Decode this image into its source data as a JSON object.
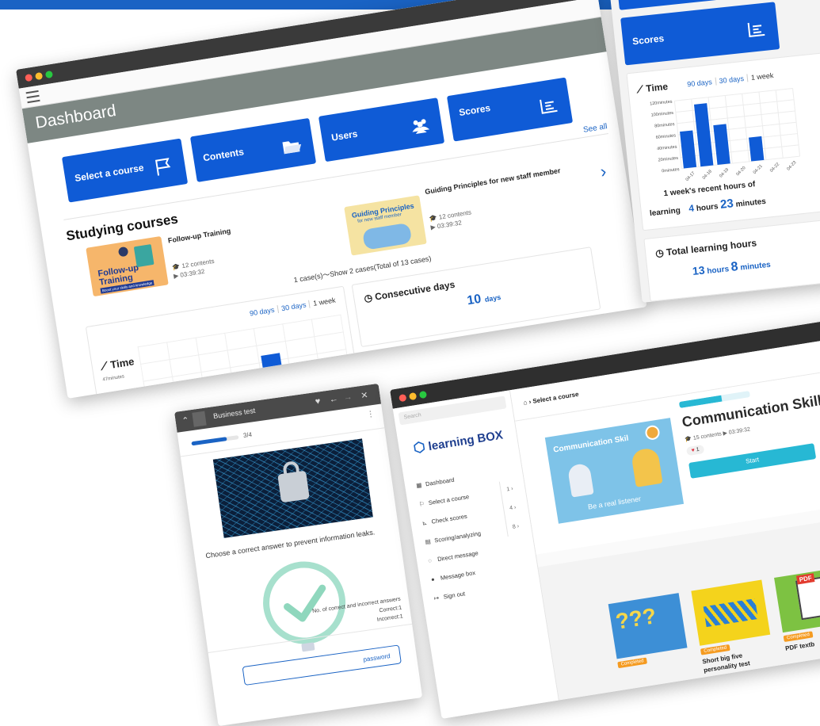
{
  "dashboard": {
    "title": "Dashboard",
    "tiles": [
      {
        "label": "Select a course",
        "icon": "flag-icon"
      },
      {
        "label": "Contents",
        "icon": "folder-icon"
      },
      {
        "label": "Users",
        "icon": "users-icon"
      },
      {
        "label": "Scores",
        "icon": "scores-icon"
      }
    ],
    "see_all": "See all",
    "studying_title": "Studying courses",
    "courses": [
      {
        "name": "Follow-up Training",
        "thumb_title": "Follow-up Training",
        "thumb_sub": "Boost your skills and knowledge",
        "contents": "12 contents",
        "duration": "03:39:32"
      },
      {
        "name": "Guiding Principles for new staff member",
        "thumb_title": "Guiding Principles",
        "thumb_sub": "for new staff member",
        "contents": "12 contents",
        "duration": "03:39:32"
      }
    ],
    "pager": "1 case(s)～Show 2 cases(Total of 13 cases)",
    "time_panel": {
      "title": "Time",
      "tabs": [
        "90 days",
        "30 days",
        "1 week"
      ],
      "y_ticks": [
        "47minutes",
        "40minutes"
      ]
    },
    "consecutive": {
      "title": "Consecutive days",
      "value": "10",
      "unit": "days"
    }
  },
  "scores": {
    "title": "Scores",
    "time_title": "Time",
    "tabs": [
      "90 days",
      "30 days",
      "1 week"
    ],
    "summary_line1": "1 week's recent hours of",
    "summary_prefix": "learning",
    "summary_hours": "4",
    "summary_hours_unit": "hours",
    "summary_minutes": "23",
    "summary_minutes_unit": "minutes",
    "total_title": "Total learning hours",
    "total_hours": "13",
    "total_hours_unit": "hours",
    "total_minutes": "8",
    "total_minutes_unit": "minutes"
  },
  "chart_data": {
    "type": "bar",
    "categories": [
      "04-17",
      "04-18",
      "04-19",
      "04-20",
      "04-21",
      "04-22",
      "04-23"
    ],
    "values": [
      65,
      110,
      70,
      0,
      42,
      0,
      0
    ],
    "ylim": [
      0,
      120
    ],
    "y_ticks": [
      "120minutes",
      "100minutes",
      "80minutes",
      "60minutes",
      "40minutes",
      "20minutes",
      "0minutes"
    ],
    "grid": true
  },
  "quiz": {
    "title": "Business test",
    "progress_label": "3/4",
    "progress": 0.75,
    "question": "Choose a correct answer to prevent information leaks.",
    "result_title": "No. of correct and incorrect answers",
    "correct": "Correct:1",
    "incorrect": "Incorrect:1",
    "bottom_button": "password"
  },
  "lbox": {
    "search_placeholder": "Search",
    "logo": "learning BOX",
    "nav": [
      {
        "label": "Dashboard",
        "icon": "dashboard-icon",
        "count": ""
      },
      {
        "label": "Select a course",
        "icon": "flag-icon",
        "count": "1"
      },
      {
        "label": "Check scores",
        "icon": "scores-icon",
        "count": "4"
      },
      {
        "label": "Scoring/analyzing",
        "icon": "document-icon",
        "count": "8"
      },
      {
        "label": "Direct message",
        "icon": "chat-icon",
        "count": ""
      },
      {
        "label": "Message box",
        "icon": "messages-icon",
        "count": ""
      },
      {
        "label": "Sign out",
        "icon": "signout-icon",
        "count": ""
      }
    ],
    "breadcrumb": "Select a course",
    "course_title": "Communication Skills",
    "course_thumb_title": "Communication Skil",
    "course_thumb_sub": "Be a real listener",
    "course_meta_contents": "15 contents",
    "course_meta_duration": "03:39:32",
    "likes": "1",
    "start_button": "Start",
    "cards": [
      {
        "badge": "Completed",
        "title": ""
      },
      {
        "badge": "Completed",
        "title": "Short big five",
        "title2": "personality test"
      },
      {
        "badge": "Completed",
        "title": "PDF textb"
      }
    ]
  }
}
